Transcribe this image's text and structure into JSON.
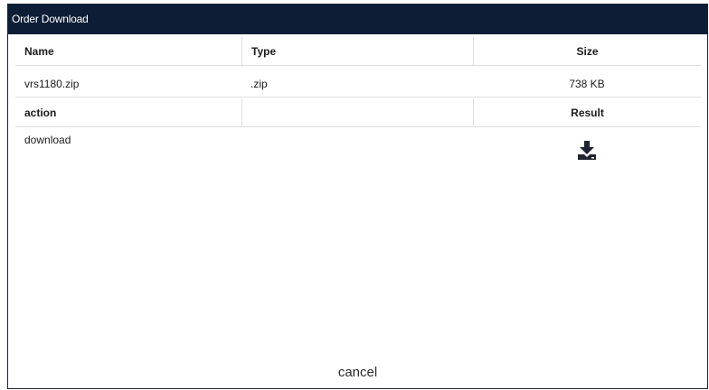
{
  "dialog": {
    "title": "Order Download"
  },
  "file_table": {
    "headers": [
      "Name",
      "Type",
      "Size"
    ],
    "rows": [
      [
        "vrs1180.zip",
        ".zip",
        "738 KB"
      ]
    ]
  },
  "action_table": {
    "headers": [
      "action",
      "",
      "Result"
    ],
    "rows": [
      [
        "download",
        "",
        ""
      ]
    ],
    "result_icon": "download-icon"
  },
  "footer": {
    "cancel_label": "cancel"
  }
}
